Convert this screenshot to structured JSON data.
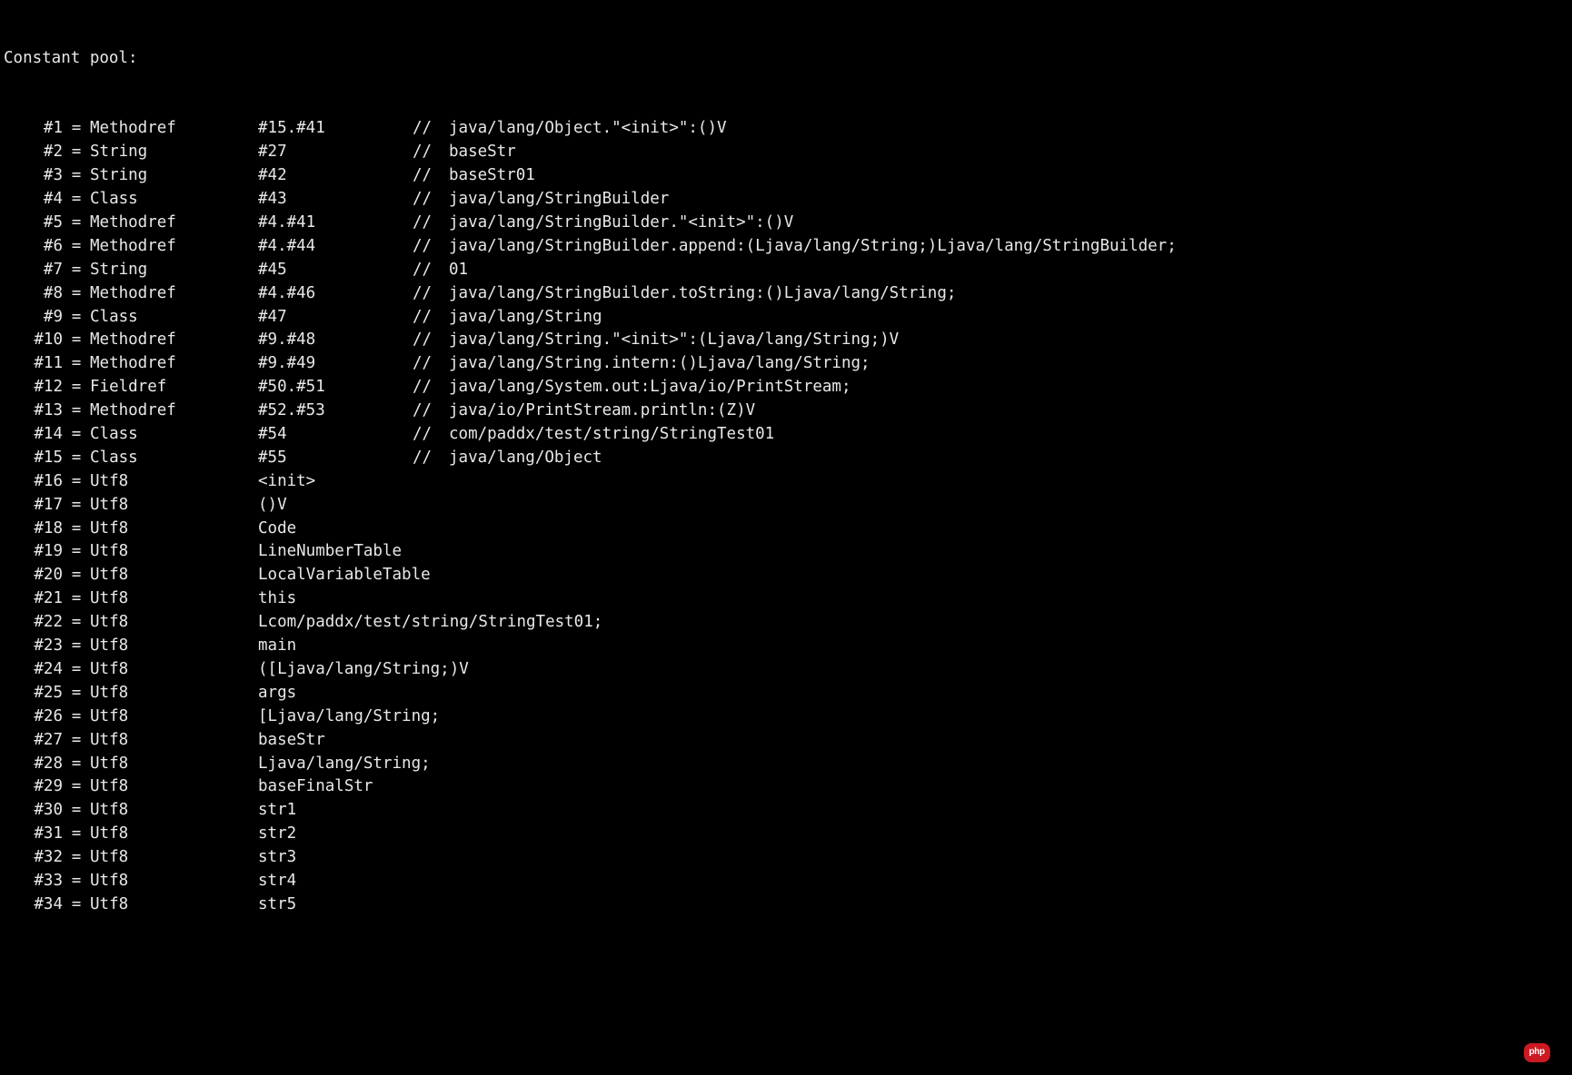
{
  "header": "Constant pool:",
  "badge": "php",
  "entries": [
    {
      "num": "#1",
      "eq": "=",
      "type": "Methodref",
      "ref": "#15.#41",
      "sep": "//",
      "comment": "java/lang/Object.\"<init>\":()V"
    },
    {
      "num": "#2",
      "eq": "=",
      "type": "String",
      "ref": "#27",
      "sep": "//",
      "comment": "baseStr"
    },
    {
      "num": "#3",
      "eq": "=",
      "type": "String",
      "ref": "#42",
      "sep": "//",
      "comment": "baseStr01"
    },
    {
      "num": "#4",
      "eq": "=",
      "type": "Class",
      "ref": "#43",
      "sep": "//",
      "comment": "java/lang/StringBuilder"
    },
    {
      "num": "#5",
      "eq": "=",
      "type": "Methodref",
      "ref": "#4.#41",
      "sep": "//",
      "comment": "java/lang/StringBuilder.\"<init>\":()V"
    },
    {
      "num": "#6",
      "eq": "=",
      "type": "Methodref",
      "ref": "#4.#44",
      "sep": "//",
      "comment": "java/lang/StringBuilder.append:(Ljava/lang/String;)Ljava/lang/StringBuilder;"
    },
    {
      "num": "#7",
      "eq": "=",
      "type": "String",
      "ref": "#45",
      "sep": "//",
      "comment": "01"
    },
    {
      "num": "#8",
      "eq": "=",
      "type": "Methodref",
      "ref": "#4.#46",
      "sep": "//",
      "comment": "java/lang/StringBuilder.toString:()Ljava/lang/String;"
    },
    {
      "num": "#9",
      "eq": "=",
      "type": "Class",
      "ref": "#47",
      "sep": "//",
      "comment": "java/lang/String"
    },
    {
      "num": "#10",
      "eq": "=",
      "type": "Methodref",
      "ref": "#9.#48",
      "sep": "//",
      "comment": "java/lang/String.\"<init>\":(Ljava/lang/String;)V"
    },
    {
      "num": "#11",
      "eq": "=",
      "type": "Methodref",
      "ref": "#9.#49",
      "sep": "//",
      "comment": "java/lang/String.intern:()Ljava/lang/String;"
    },
    {
      "num": "#12",
      "eq": "=",
      "type": "Fieldref",
      "ref": "#50.#51",
      "sep": "//",
      "comment": "java/lang/System.out:Ljava/io/PrintStream;"
    },
    {
      "num": "#13",
      "eq": "=",
      "type": "Methodref",
      "ref": "#52.#53",
      "sep": "//",
      "comment": "java/io/PrintStream.println:(Z)V"
    },
    {
      "num": "#14",
      "eq": "=",
      "type": "Class",
      "ref": "#54",
      "sep": "//",
      "comment": "com/paddx/test/string/StringTest01"
    },
    {
      "num": "#15",
      "eq": "=",
      "type": "Class",
      "ref": "#55",
      "sep": "//",
      "comment": "java/lang/Object"
    },
    {
      "num": "#16",
      "eq": "=",
      "type": "Utf8",
      "ref": "<init>",
      "sep": "",
      "comment": ""
    },
    {
      "num": "#17",
      "eq": "=",
      "type": "Utf8",
      "ref": "()V",
      "sep": "",
      "comment": ""
    },
    {
      "num": "#18",
      "eq": "=",
      "type": "Utf8",
      "ref": "Code",
      "sep": "",
      "comment": ""
    },
    {
      "num": "#19",
      "eq": "=",
      "type": "Utf8",
      "ref": "LineNumberTable",
      "sep": "",
      "comment": ""
    },
    {
      "num": "#20",
      "eq": "=",
      "type": "Utf8",
      "ref": "LocalVariableTable",
      "sep": "",
      "comment": ""
    },
    {
      "num": "#21",
      "eq": "=",
      "type": "Utf8",
      "ref": "this",
      "sep": "",
      "comment": ""
    },
    {
      "num": "#22",
      "eq": "=",
      "type": "Utf8",
      "ref": "Lcom/paddx/test/string/StringTest01;",
      "sep": "",
      "comment": ""
    },
    {
      "num": "#23",
      "eq": "=",
      "type": "Utf8",
      "ref": "main",
      "sep": "",
      "comment": ""
    },
    {
      "num": "#24",
      "eq": "=",
      "type": "Utf8",
      "ref": "([Ljava/lang/String;)V",
      "sep": "",
      "comment": ""
    },
    {
      "num": "#25",
      "eq": "=",
      "type": "Utf8",
      "ref": "args",
      "sep": "",
      "comment": ""
    },
    {
      "num": "#26",
      "eq": "=",
      "type": "Utf8",
      "ref": "[Ljava/lang/String;",
      "sep": "",
      "comment": ""
    },
    {
      "num": "#27",
      "eq": "=",
      "type": "Utf8",
      "ref": "baseStr",
      "sep": "",
      "comment": ""
    },
    {
      "num": "#28",
      "eq": "=",
      "type": "Utf8",
      "ref": "Ljava/lang/String;",
      "sep": "",
      "comment": ""
    },
    {
      "num": "#29",
      "eq": "=",
      "type": "Utf8",
      "ref": "baseFinalStr",
      "sep": "",
      "comment": ""
    },
    {
      "num": "#30",
      "eq": "=",
      "type": "Utf8",
      "ref": "str1",
      "sep": "",
      "comment": ""
    },
    {
      "num": "#31",
      "eq": "=",
      "type": "Utf8",
      "ref": "str2",
      "sep": "",
      "comment": ""
    },
    {
      "num": "#32",
      "eq": "=",
      "type": "Utf8",
      "ref": "str3",
      "sep": "",
      "comment": ""
    },
    {
      "num": "#33",
      "eq": "=",
      "type": "Utf8",
      "ref": "str4",
      "sep": "",
      "comment": ""
    },
    {
      "num": "#34",
      "eq": "=",
      "type": "Utf8",
      "ref": "str5",
      "sep": "",
      "comment": ""
    }
  ]
}
